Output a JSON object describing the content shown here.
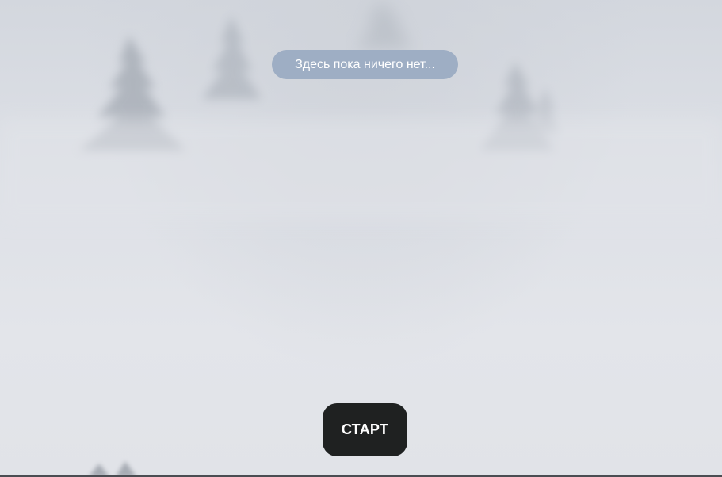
{
  "empty_message": "Здесь пока ничего нет...",
  "start_button_label": "СТАРТ",
  "background": {
    "description_icon": "foggy-forest-background",
    "colors": {
      "fog": "#dfe2e8",
      "tree": "#8a919c",
      "pill": "#9eaec4",
      "button": "#1f2121"
    }
  }
}
